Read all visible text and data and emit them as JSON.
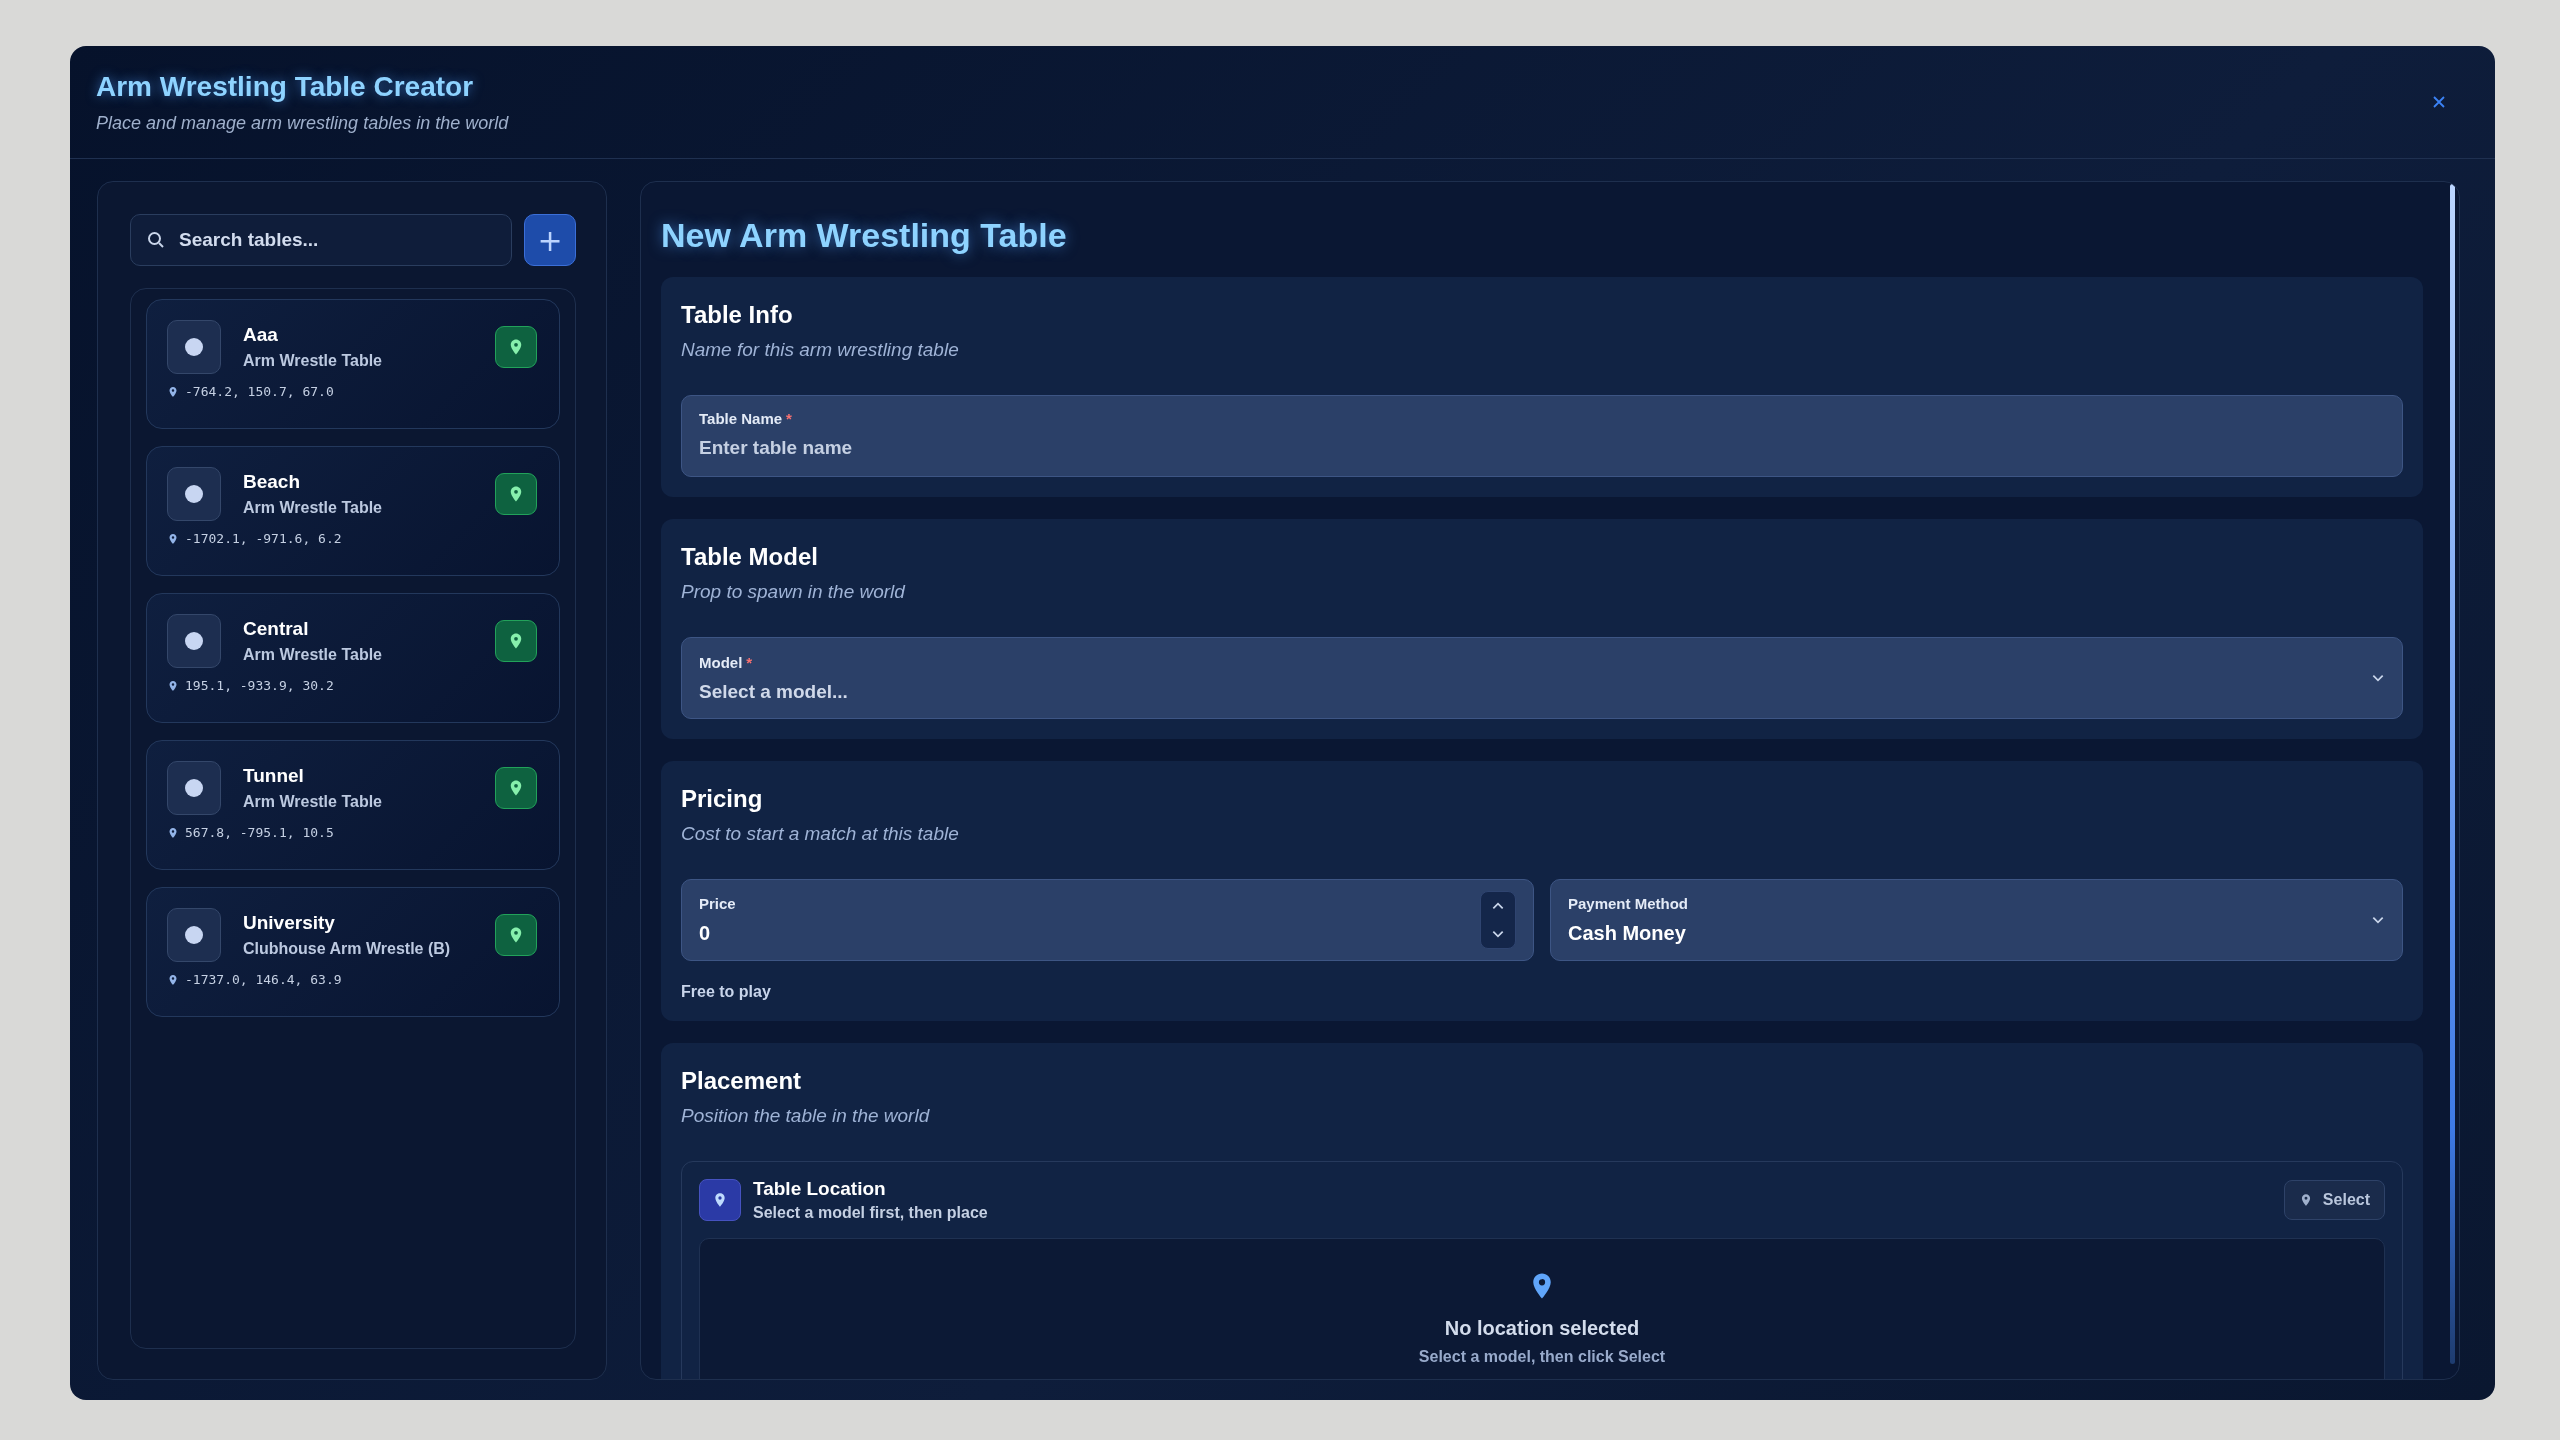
{
  "window": {
    "title": "Arm Wrestling Table Creator",
    "subtitle": "Place and manage arm wrestling tables in the world"
  },
  "sidebar": {
    "search": {
      "placeholder": "Search tables..."
    },
    "add_button": "+",
    "tables": [
      {
        "name": "Aaa",
        "model": "Arm Wrestle Table",
        "coords": "-764.2, 150.7, 67.0"
      },
      {
        "name": "Beach",
        "model": "Arm Wrestle Table",
        "coords": "-1702.1, -971.6, 6.2"
      },
      {
        "name": "Central",
        "model": "Arm Wrestle Table",
        "coords": "195.1, -933.9, 30.2"
      },
      {
        "name": "Tunnel",
        "model": "Arm Wrestle Table",
        "coords": "567.8, -795.1, 10.5"
      },
      {
        "name": "University",
        "model": "Clubhouse Arm Wrestle (B)",
        "coords": "-1737.0, 146.4, 63.9"
      }
    ]
  },
  "form": {
    "title": "New Arm Wrestling Table",
    "table_info": {
      "title": "Table Info",
      "description": "Name for this arm wrestling table",
      "field": {
        "label": "Table Name",
        "required_mark": "*",
        "placeholder": "Enter table name"
      }
    },
    "table_model": {
      "title": "Table Model",
      "description": "Prop to spawn in the world",
      "field": {
        "label": "Model",
        "required_mark": "*",
        "placeholder": "Select a model..."
      }
    },
    "pricing": {
      "title": "Pricing",
      "description": "Cost to start a match at this table",
      "price": {
        "label": "Price",
        "value": "0"
      },
      "payment": {
        "label": "Payment Method",
        "value": "Cash Money"
      },
      "hint": "Free to play"
    },
    "placement": {
      "title": "Placement",
      "description": "Position the table in the world",
      "location": {
        "title": "Table Location",
        "subtitle": "Select a model first, then place",
        "button": "Select",
        "empty_title": "No location selected",
        "empty_text": "Select a model, then click Select"
      }
    }
  }
}
